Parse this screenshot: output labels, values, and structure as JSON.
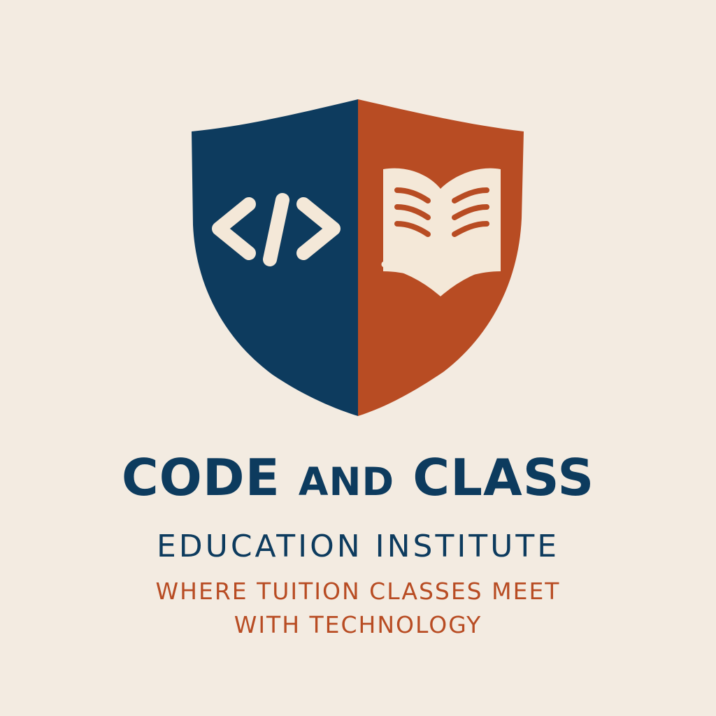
{
  "logo": {
    "title_word_1": "CODE",
    "title_word_2": "AND",
    "title_word_3": "CLASS",
    "subtitle": "EDUCATION INSTITUTE",
    "tagline_line_1": "WHERE TUITION CLASSES MEET",
    "tagline_line_2": "WITH TECHNOLOGY"
  },
  "colors": {
    "background": "#f3ebe1",
    "navy": "#0d3b5e",
    "rust": "#b84c23",
    "icon_cream": "#f4e8d8"
  },
  "icons": {
    "left_icon": "code-brackets-icon",
    "right_icon": "open-book-icon"
  }
}
